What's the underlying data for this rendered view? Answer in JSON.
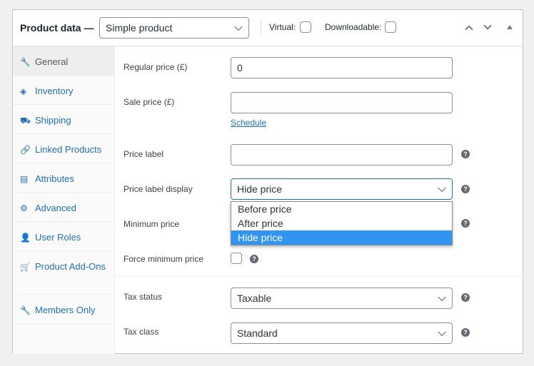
{
  "header": {
    "title": "Product data —",
    "product_type": "Simple product",
    "virtual_label": "Virtual:",
    "downloadable_label": "Downloadable:",
    "virtual_checked": false,
    "downloadable_checked": false
  },
  "sidebar": {
    "items": [
      {
        "label": "General",
        "icon": "wrench-icon",
        "glyph": "🔧",
        "active": true
      },
      {
        "label": "Inventory",
        "icon": "tag-icon",
        "glyph": "◈"
      },
      {
        "label": "Shipping",
        "icon": "truck-icon",
        "glyph": "⛟"
      },
      {
        "label": "Linked Products",
        "icon": "link-icon",
        "glyph": "🔗"
      },
      {
        "label": "Attributes",
        "icon": "list-icon",
        "glyph": "▤"
      },
      {
        "label": "Advanced",
        "icon": "gear-icon",
        "glyph": "⚙"
      },
      {
        "label": "User Roles",
        "icon": "user-icon",
        "glyph": "👤"
      },
      {
        "label": "Product Add-Ons",
        "icon": "cart-icon",
        "glyph": "🛒"
      },
      {
        "label": "Members Only",
        "icon": "wrench-icon",
        "glyph": "🔧"
      }
    ]
  },
  "fields": {
    "regular_price": {
      "label": "Regular price (£)",
      "value": "0"
    },
    "sale_price": {
      "label": "Sale price (£)",
      "value": "",
      "schedule_link": "Schedule"
    },
    "price_label": {
      "label": "Price label",
      "value": ""
    },
    "price_label_display": {
      "label": "Price label display",
      "value": "Hide price",
      "options": [
        "Before price",
        "After price",
        "Hide price"
      ]
    },
    "minimum_price": {
      "label": "Minimum price"
    },
    "force_minimum_price": {
      "label": "Force minimum price",
      "checked": false
    },
    "tax_status": {
      "label": "Tax status",
      "value": "Taxable"
    },
    "tax_class": {
      "label": "Tax class",
      "value": "Standard"
    }
  },
  "help_glyph": "?"
}
